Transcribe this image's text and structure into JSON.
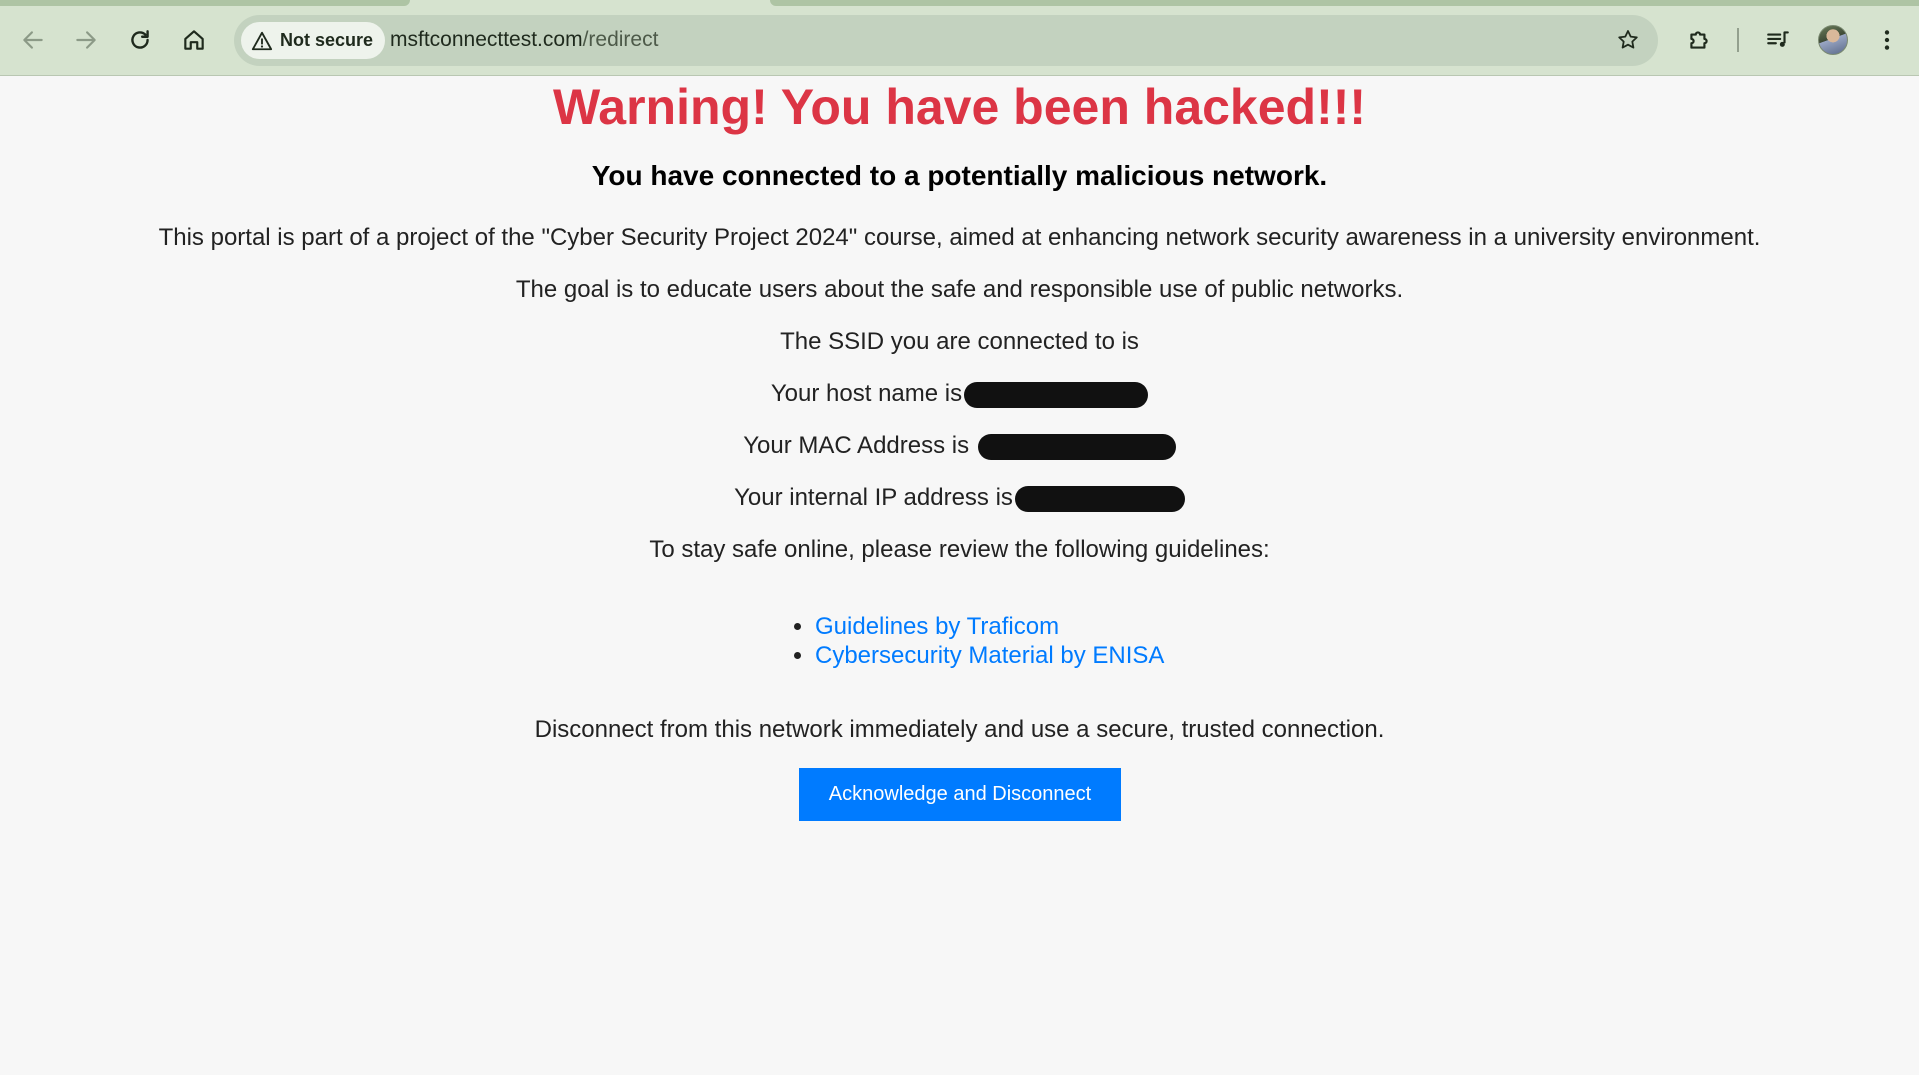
{
  "browser": {
    "security_chip": "Not secure",
    "url_host": "msftconnecttest.com",
    "url_path": "/redirect",
    "icons": {
      "back": "back-arrow-icon",
      "forward": "forward-arrow-icon",
      "reload": "reload-icon",
      "home": "home-icon",
      "warning": "warning-triangle-icon",
      "bookmark": "star-icon",
      "extensions": "puzzle-icon",
      "media": "media-controls-icon",
      "menu": "three-dot-menu-icon"
    },
    "theme_color": "#d6e3cf"
  },
  "page": {
    "headline": "Warning! You have been hacked!!!",
    "subhead": "You have connected to a potentially malicious network.",
    "intro": "This portal is part of a project of the \"Cyber Security Project 2024\" course, aimed at enhancing network security awareness in a university environment.",
    "goal": "The goal is to educate users about the safe and responsible use of public networks.",
    "ssid_label": "The SSID you are connected to is",
    "host_label": "Your host name is",
    "mac_label": "Your MAC Address is",
    "ip_label": "Your internal IP address is",
    "guidelines_intro": "To stay safe online, please review the following guidelines:",
    "links": [
      {
        "label": "Guidelines by Traficom"
      },
      {
        "label": "Cybersecurity Material by ENISA"
      }
    ],
    "disconnect_text": "Disconnect from this network immediately and use a secure, trusted connection.",
    "button_label": "Acknowledge and Disconnect",
    "colors": {
      "headline": "#dc3545",
      "link": "#007bff",
      "button": "#007bff"
    }
  }
}
